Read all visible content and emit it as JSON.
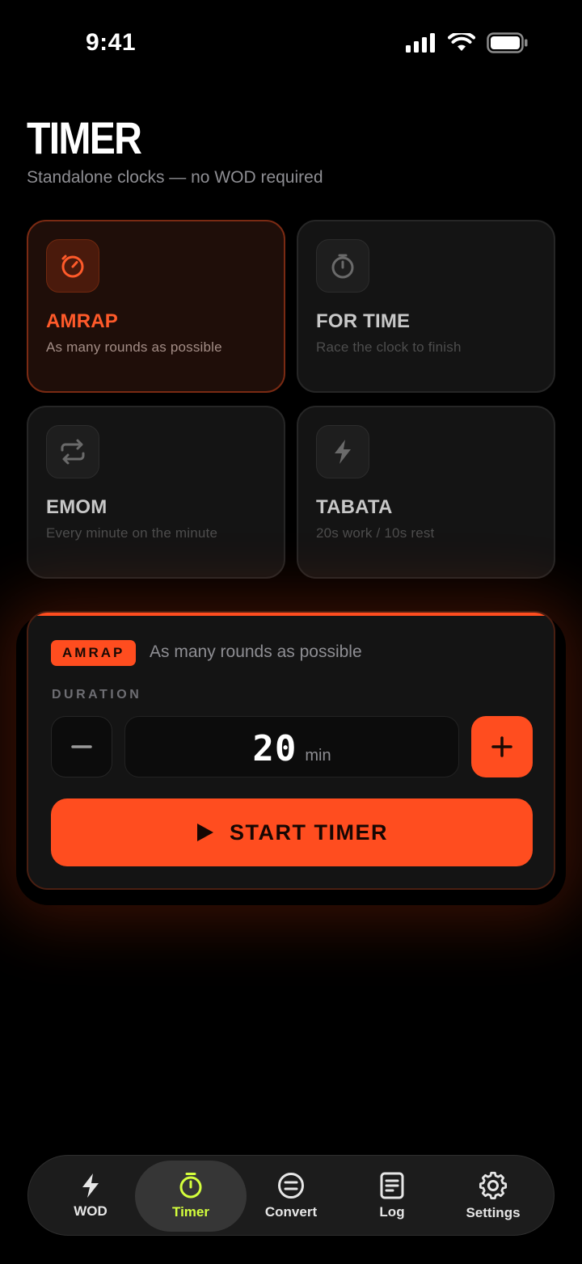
{
  "status_bar": {
    "time": "9:41"
  },
  "header": {
    "title": "TIMER",
    "subtitle": "Standalone clocks — no WOD required"
  },
  "modes": [
    {
      "name": "AMRAP",
      "desc": "As many rounds as possible",
      "icon": "timer-icon",
      "selected": true
    },
    {
      "name": "FOR TIME",
      "desc": "Race the clock to finish",
      "icon": "stopwatch-icon",
      "selected": false
    },
    {
      "name": "EMOM",
      "desc": "Every minute on the minute",
      "icon": "repeat-icon",
      "selected": false
    },
    {
      "name": "TABATA",
      "desc": "20s work / 10s rest",
      "icon": "lightning-icon",
      "selected": false
    }
  ],
  "config": {
    "badge": "AMRAP",
    "desc": "As many rounds as possible",
    "duration_label": "DURATION",
    "duration_value": "20",
    "duration_unit": "min",
    "start_label": "START TIMER"
  },
  "tab_bar": {
    "items": [
      {
        "label": "WOD",
        "icon": "lightning-icon",
        "active": false
      },
      {
        "label": "Timer",
        "icon": "timer-icon",
        "active": true
      },
      {
        "label": "Convert",
        "icon": "convert-icon",
        "active": false
      },
      {
        "label": "Log",
        "icon": "log-icon",
        "active": false
      },
      {
        "label": "Settings",
        "icon": "gear-icon",
        "active": false
      }
    ]
  },
  "colors": {
    "accent": "#ff4d1f",
    "active_tab": "#d4ff3c",
    "background": "#000000",
    "card": "#141414"
  }
}
